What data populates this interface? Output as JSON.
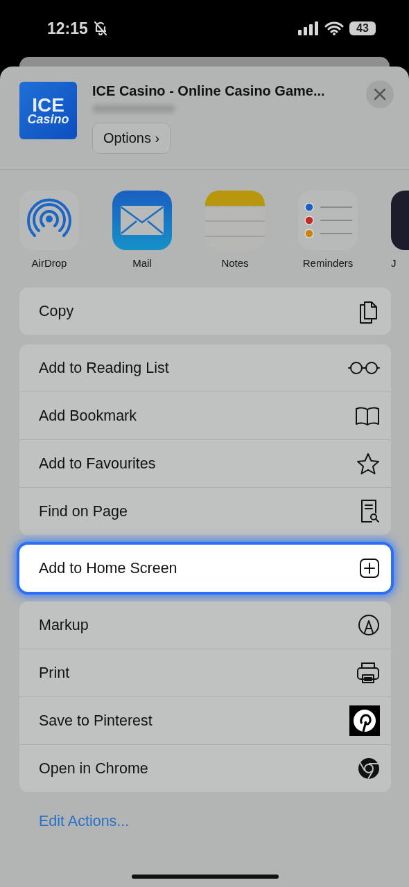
{
  "status_bar": {
    "time": "12:15",
    "silent": true,
    "battery": "43"
  },
  "header": {
    "logo_lines": [
      "ICE",
      "Casino"
    ],
    "title": "ICE Casino - Online Casino Game...",
    "options_button": "Options ›"
  },
  "apps": [
    {
      "label": "AirDrop",
      "kind": "airdrop"
    },
    {
      "label": "Mail",
      "kind": "mail"
    },
    {
      "label": "Notes",
      "kind": "notes"
    },
    {
      "label": "Reminders",
      "kind": "reminders"
    },
    {
      "label": "J",
      "kind": "partial"
    }
  ],
  "action_groups": [
    {
      "highlighted": false,
      "items": [
        {
          "label": "Copy",
          "kind": "copy"
        }
      ]
    },
    {
      "highlighted": false,
      "items": [
        {
          "label": "Add to Reading List",
          "kind": "glasses"
        },
        {
          "label": "Add Bookmark",
          "kind": "book"
        },
        {
          "label": "Add to Favourites",
          "kind": "star"
        },
        {
          "label": "Find on Page",
          "kind": "find"
        }
      ]
    },
    {
      "highlighted": true,
      "items": [
        {
          "label": "Add to Home Screen",
          "kind": "plus"
        }
      ]
    },
    {
      "highlighted": false,
      "items": [
        {
          "label": "Markup",
          "kind": "markup"
        },
        {
          "label": "Print",
          "kind": "print"
        },
        {
          "label": "Save to Pinterest",
          "kind": "pinterest"
        },
        {
          "label": "Open in Chrome",
          "kind": "chrome"
        }
      ]
    }
  ],
  "edit_actions": "Edit Actions..."
}
